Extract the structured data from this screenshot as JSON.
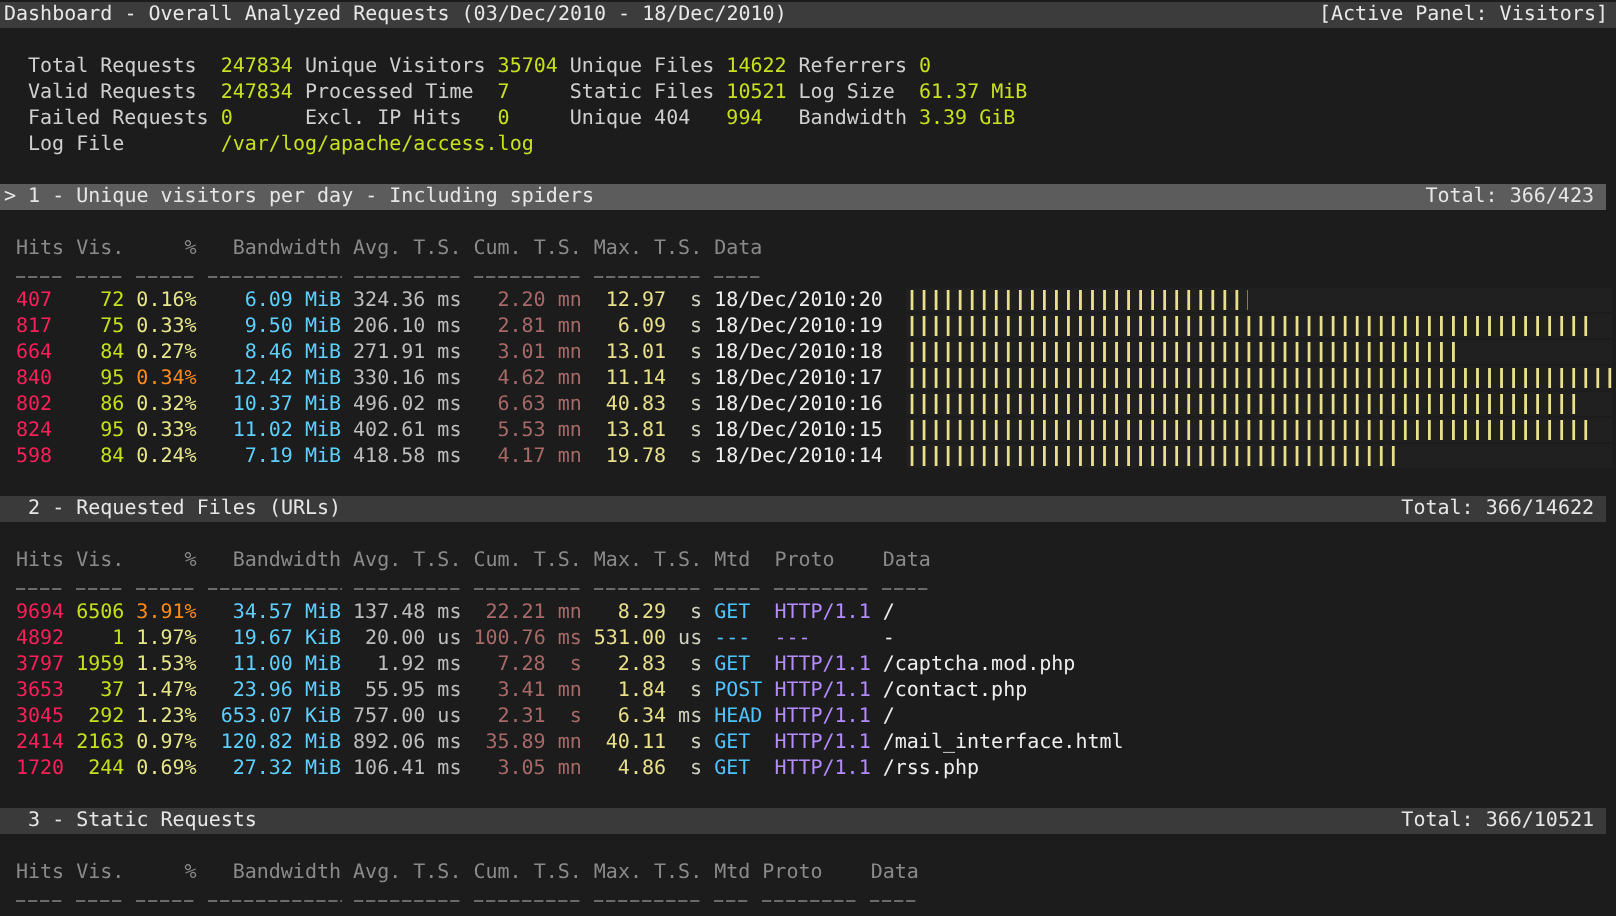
{
  "title_bar": {
    "title": "Dashboard - Overall Analyzed Requests (03/Dec/2010 - 18/Dec/2010)",
    "active_panel": "[Active Panel: Visitors]"
  },
  "general_stats": [
    {
      "label": "Total Requests",
      "value": "247834"
    },
    {
      "label": "Unique Visitors",
      "value": "35704"
    },
    {
      "label": "Unique Files",
      "value": "14622"
    },
    {
      "label": "Referrers",
      "value": "0"
    },
    {
      "label": "Valid Requests",
      "value": "247834"
    },
    {
      "label": "Processed Time",
      "value": "7"
    },
    {
      "label": "Static Files",
      "value": "10521"
    },
    {
      "label": "Log Size",
      "value": "61.37 MiB"
    },
    {
      "label": "Failed Requests",
      "value": "0"
    },
    {
      "label": "Excl. IP Hits",
      "value": "0"
    },
    {
      "label": "Unique 404",
      "value": "994"
    },
    {
      "label": "Bandwidth",
      "value": "3.39 GiB"
    },
    {
      "label": "Log File",
      "value": "/var/log/apache/access.log"
    }
  ],
  "panels": [
    {
      "marker": ">",
      "title": "1 - Unique visitors per day - Including spiders",
      "total": "Total: 366/423",
      "selected": true,
      "columns": [
        {
          "label": "Hits",
          "kind": "hits"
        },
        {
          "label": "Vis.",
          "kind": "visitors"
        },
        {
          "label": "%",
          "kind": "percent"
        },
        {
          "label": "Bandwidth",
          "kind": "bandwidth"
        },
        {
          "label": "Avg. T.S.",
          "kind": "time_avg"
        },
        {
          "label": "Cum. T.S.",
          "kind": "time_cum"
        },
        {
          "label": "Max. T.S.",
          "kind": "time_max"
        },
        {
          "label": "Data",
          "kind": "data"
        }
      ],
      "rows": [
        {
          "cells": [
            "407",
            "72",
            "0.16%",
            "6.09 MiB",
            "324.36 ms",
            "2.20 mn",
            "12.97 s",
            "18/Dec/2010:20"
          ],
          "percent_highlighted": false,
          "level": 0.483
        },
        {
          "cells": [
            "817",
            "75",
            "0.33%",
            "9.50 MiB",
            "206.10 ms",
            "2.81 mn",
            "6.09 s",
            "18/Dec/2010:19"
          ],
          "percent_highlighted": false,
          "level": 0.967
        },
        {
          "cells": [
            "664",
            "84",
            "0.27%",
            "8.46 MiB",
            "271.91 ms",
            "3.01 mn",
            "13.01 s",
            "18/Dec/2010:18"
          ],
          "percent_highlighted": false,
          "level": 0.783
        },
        {
          "cells": [
            "840",
            "95",
            "0.34%",
            "12.42 MiB",
            "330.16 ms",
            "4.62 mn",
            "11.14 s",
            "18/Dec/2010:17"
          ],
          "percent_highlighted": true,
          "level": 1
        },
        {
          "cells": [
            "802",
            "86",
            "0.32%",
            "10.37 MiB",
            "496.02 ms",
            "6.63 mn",
            "40.83 s",
            "18/Dec/2010:16"
          ],
          "percent_highlighted": false,
          "level": 0.95
        },
        {
          "cells": [
            "824",
            "95",
            "0.33%",
            "11.02 MiB",
            "402.61 ms",
            "5.53 mn",
            "13.81 s",
            "18/Dec/2010:15"
          ],
          "percent_highlighted": false,
          "level": 0.967
        },
        {
          "cells": [
            "598",
            "84",
            "0.24%",
            "7.19 MiB",
            "418.58 ms",
            "4.17 mn",
            "19.78 s",
            "18/Dec/2010:14"
          ],
          "percent_highlighted": false,
          "level": 0.7
        }
      ]
    },
    {
      "title": "2 - Requested Files (URLs)",
      "total": "Total: 366/14622",
      "selected": false,
      "columns": [
        {
          "label": "Hits",
          "kind": "hits"
        },
        {
          "label": "Vis.",
          "kind": "visitors"
        },
        {
          "label": "%",
          "kind": "percent"
        },
        {
          "label": "Bandwidth",
          "kind": "bandwidth"
        },
        {
          "label": "Avg. T.S.",
          "kind": "time_avg"
        },
        {
          "label": "Cum. T.S.",
          "kind": "time_cum"
        },
        {
          "label": "Max. T.S.",
          "kind": "time_max"
        },
        {
          "label": "Mtd",
          "kind": "method"
        },
        {
          "label": "Proto",
          "kind": "protocol"
        },
        {
          "label": "Data",
          "kind": "data"
        }
      ],
      "rows": [
        {
          "cells": [
            "9694",
            "6506",
            "3.91%",
            "34.57 MiB",
            "137.48 ms",
            "22.21 mn",
            "8.29 s",
            "GET",
            "HTTP/1.1",
            "/"
          ],
          "percent_highlighted": true
        },
        {
          "cells": [
            "4892",
            "1",
            "1.97%",
            "19.67 KiB",
            "20.00 us",
            "100.76 ms",
            "531.00 us",
            "---",
            "---",
            "-"
          ],
          "percent_highlighted": false
        },
        {
          "cells": [
            "3797",
            "1959",
            "1.53%",
            "11.00 MiB",
            "1.92 ms",
            "7.28 s",
            "2.83 s",
            "GET",
            "HTTP/1.1",
            "/captcha.mod.php"
          ],
          "percent_highlighted": false
        },
        {
          "cells": [
            "3653",
            "37",
            "1.47%",
            "23.96 MiB",
            "55.95 ms",
            "3.41 mn",
            "1.84 s",
            "POST",
            "HTTP/1.1",
            "/contact.php"
          ],
          "percent_highlighted": false
        },
        {
          "cells": [
            "3045",
            "292",
            "1.23%",
            "653.07 KiB",
            "757.00 us",
            "2.31 s",
            "6.34 ms",
            "HEAD",
            "HTTP/1.1",
            "/"
          ],
          "percent_highlighted": false
        },
        {
          "cells": [
            "2414",
            "2163",
            "0.97%",
            "120.82 MiB",
            "892.06 ms",
            "35.89 mn",
            "40.11 s",
            "GET",
            "HTTP/1.1",
            "/mail_interface.html"
          ],
          "percent_highlighted": false
        },
        {
          "cells": [
            "1720",
            "244",
            "0.69%",
            "27.32 MiB",
            "106.41 ms",
            "3.05 mn",
            "4.86 s",
            "GET",
            "HTTP/1.1",
            "/rss.php"
          ],
          "percent_highlighted": false
        }
      ]
    },
    {
      "title": "3 - Static Requests",
      "total": "Total: 366/10521",
      "selected": false,
      "columns": [
        {
          "label": "Hits",
          "kind": "hits"
        },
        {
          "label": "Vis.",
          "kind": "visitors"
        },
        {
          "label": "%",
          "kind": "percent"
        },
        {
          "label": "Bandwidth",
          "kind": "bandwidth"
        },
        {
          "label": "Avg. T.S.",
          "kind": "time_avg"
        },
        {
          "label": "Cum. T.S.",
          "kind": "time_cum"
        },
        {
          "label": "Max. T.S.",
          "kind": "time_max"
        },
        {
          "label": "Mtd",
          "kind": "method"
        },
        {
          "label": "Proto",
          "kind": "protocol"
        },
        {
          "label": "Data",
          "kind": "data"
        }
      ]
    }
  ]
}
